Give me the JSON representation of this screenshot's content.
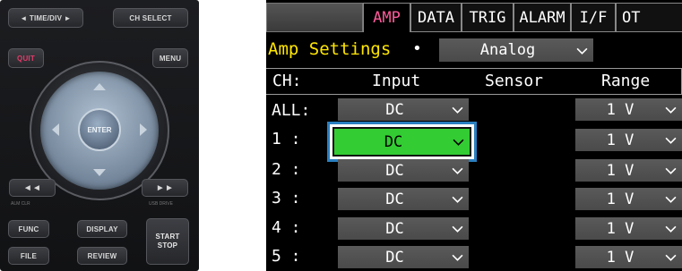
{
  "keypad": {
    "time_div": "◄ TIME/DIV ►",
    "ch_select": "CH SELECT",
    "quit": "QUIT",
    "menu": "MENU",
    "enter": "ENTER",
    "func": "FUNC",
    "display": "DISPLAY",
    "start_stop_1": "START",
    "start_stop_2": "STOP",
    "file": "FILE",
    "review": "REVIEW",
    "rewind": "◄◄",
    "forward": "►►",
    "hint_left": "ALM CLR",
    "hint_right": "USB DRIVE"
  },
  "tabs": [
    {
      "label": "AMP",
      "active": true
    },
    {
      "label": "DATA"
    },
    {
      "label": "TRIG"
    },
    {
      "label": "ALARM"
    },
    {
      "label": "I/F"
    },
    {
      "label": "OT"
    }
  ],
  "amp_settings": {
    "title": "Amp Settings",
    "separator": "•",
    "mode": "Analog"
  },
  "table": {
    "headers": {
      "ch": "CH:",
      "input": "Input",
      "sensor": "Sensor",
      "range": "Range"
    },
    "rows": [
      {
        "ch": "ALL:",
        "input": "DC",
        "range": "1 V"
      },
      {
        "ch": "1  :",
        "input": "DC",
        "range": "1 V",
        "selected": true
      },
      {
        "ch": "2  :",
        "input": "DC",
        "range": "1 V"
      },
      {
        "ch": "3  :",
        "input": "DC",
        "range": "1 V"
      },
      {
        "ch": "4  :",
        "input": "DC",
        "range": "1 V"
      },
      {
        "ch": "5  :",
        "input": "DC",
        "range": "1 V"
      }
    ]
  },
  "colors": {
    "active_tab": "#ff5a9a",
    "title": "#ffe600",
    "selected_fill": "#33cc33",
    "selection_frame": "#2a7fc0"
  }
}
